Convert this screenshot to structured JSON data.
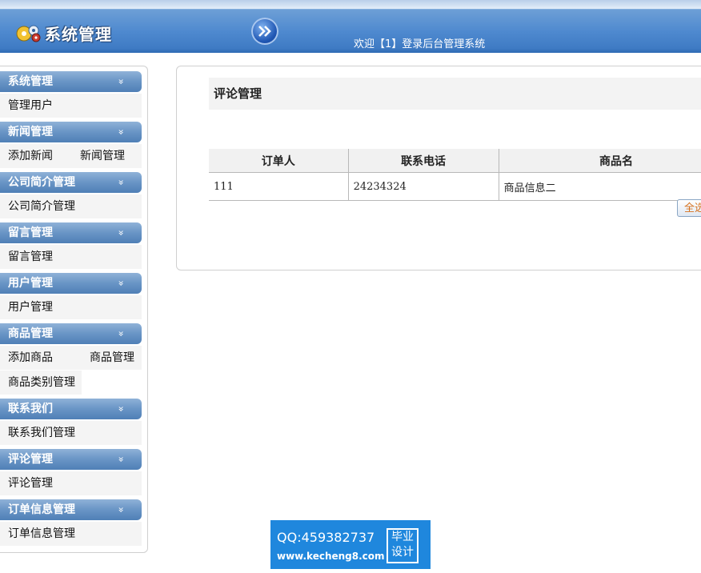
{
  "header": {
    "logo_text": "系统管理",
    "welcome": "欢迎【1】登录后台管理系统"
  },
  "sidebar": {
    "groups": [
      {
        "title": "系统管理",
        "items": [
          "管理用户"
        ]
      },
      {
        "title": "新闻管理",
        "items": [
          "添加新闻",
          "新闻管理"
        ]
      },
      {
        "title": "公司简介管理",
        "items": [
          "公司简介管理"
        ]
      },
      {
        "title": "留言管理",
        "items": [
          "留言管理"
        ]
      },
      {
        "title": "用户管理",
        "items": [
          "用户管理"
        ]
      },
      {
        "title": "商品管理",
        "items": [
          "添加商品",
          "商品管理",
          "商品类别管理"
        ]
      },
      {
        "title": "联系我们",
        "items": [
          "联系我们管理"
        ]
      },
      {
        "title": "评论管理",
        "items": [
          "评论管理"
        ]
      },
      {
        "title": "订单信息管理",
        "items": [
          "订单信息管理"
        ]
      }
    ],
    "chevron": "»"
  },
  "main": {
    "title": "评论管理",
    "table": {
      "headers": [
        "订单人",
        "联系电话",
        "商品名"
      ],
      "rows": [
        [
          "111",
          "24234324",
          "商品信息二"
        ]
      ]
    },
    "select_all_label": "全选"
  },
  "watermark": {
    "qq": "QQ:459382737",
    "url": "www.kecheng8.com",
    "badge_line1": "毕业",
    "badge_line2": "设计"
  }
}
